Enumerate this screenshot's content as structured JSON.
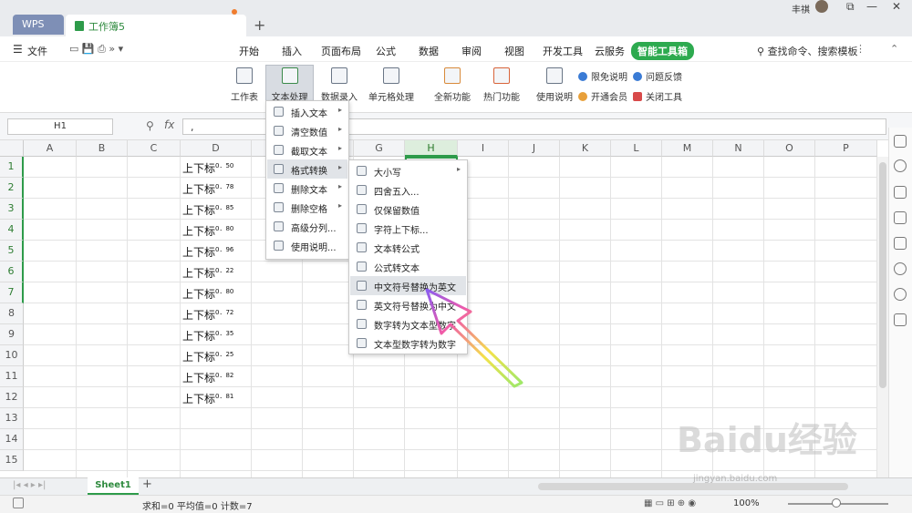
{
  "titlebar": {
    "wps_tab": "WPS",
    "doc_tab": "工作簿5",
    "user_name": "丰祺"
  },
  "menubar": {
    "file": "文件",
    "items": [
      "开始",
      "插入",
      "页面布局",
      "公式",
      "数据",
      "审阅",
      "视图",
      "开发工具",
      "云服务",
      "智能工具箱"
    ],
    "search": "查找命令、搜索模板"
  },
  "ribbon": {
    "buttons": [
      "工作表",
      "文本处理",
      "数据录入",
      "单元格处理",
      "全新功能",
      "热门功能",
      "使用说明"
    ],
    "side_links": [
      "限免说明",
      "问题反馈",
      "开通会员",
      "关闭工具"
    ]
  },
  "formula_bar": {
    "name_box": "H1",
    "fx": "fx",
    "content": ","
  },
  "columns": [
    "A",
    "B",
    "C",
    "D",
    "E",
    "F",
    "G",
    "H",
    "I",
    "J",
    "K",
    "L",
    "M",
    "N",
    "O",
    "P"
  ],
  "rows": [
    "1",
    "2",
    "3",
    "4",
    "5",
    "6",
    "7",
    "8",
    "9",
    "10",
    "11",
    "12",
    "13",
    "14",
    "15"
  ],
  "cells_d": [
    {
      "text": "上下标",
      "sup": "0．50"
    },
    {
      "text": "上下标",
      "sup": "0．78"
    },
    {
      "text": "上下标",
      "sup": "0．85"
    },
    {
      "text": "上下标",
      "sup": "0．80"
    },
    {
      "text": "上下标",
      "sup": "0．96"
    },
    {
      "text": "上下标",
      "sup": "0．22"
    },
    {
      "text": "上下标",
      "sup": "0．80"
    },
    {
      "text": "上下标",
      "sup": "0．72"
    },
    {
      "text": "上下标",
      "sup": "0．35"
    },
    {
      "text": "上下标",
      "sup": "0．25"
    },
    {
      "text": "上下标",
      "sup": "0．82"
    },
    {
      "text": "上下标",
      "sup": "0．81"
    }
  ],
  "menu_text_processing": [
    "插入文本",
    "清空数值",
    "截取文本",
    "格式转换",
    "删除文本",
    "删除空格",
    "高级分列...",
    "使用说明..."
  ],
  "menu_format_convert": [
    "大小写",
    "四舍五入...",
    "仅保留数值",
    "字符上下标...",
    "文本转公式",
    "公式转文本",
    "中文符号替换为英文",
    "英文符号替换为中文",
    "数字转为文本型数字",
    "文本型数字转为数字"
  ],
  "sheet": {
    "tab": "Sheet1",
    "add": "+"
  },
  "status": {
    "summary": "求和=0  平均值=0  计数=7",
    "zoom": "100%"
  },
  "watermark": {
    "brand": "Baidu经验",
    "url": "jingyan.baidu.com"
  },
  "colors": {
    "accent": "#2e9b4a",
    "wps_tab": "#7e8fb6"
  }
}
